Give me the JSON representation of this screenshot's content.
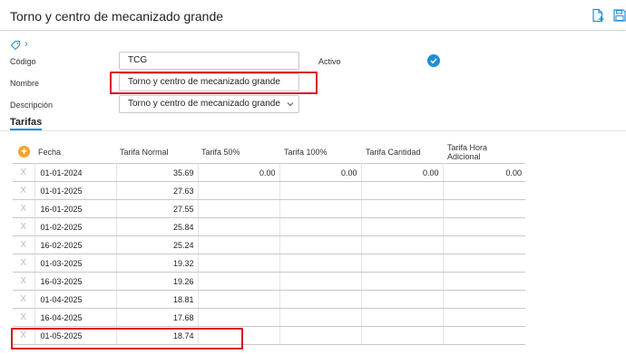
{
  "header": {
    "title": "Torno y centro de mecanizado grande"
  },
  "form": {
    "codigo_label": "Código",
    "codigo_value": "TCG",
    "nombre_label": "Nombre",
    "nombre_value": "Torno y centro de mecanizado grande",
    "descripcion_label": "Descripción",
    "descripcion_value": "Torno y centro de mecanizado grande",
    "activo_label": "Activo"
  },
  "tabs": [
    {
      "label": "Tarifas"
    }
  ],
  "table": {
    "add_icon": "+",
    "delete_icon": "X",
    "columns": {
      "fecha": "Fecha",
      "normal": "Tarifa Normal",
      "t50": "Tarifa 50%",
      "t100": "Tarifa 100%",
      "cantidad": "Tarifa Cantidad",
      "hora_adicional_1": "Tarifa Hora",
      "hora_adicional_2": "Adicional"
    },
    "rows": [
      {
        "fecha": "01-01-2024",
        "normal": "35.69",
        "t50": "0.00",
        "t100": "0.00",
        "cantidad": "0.00",
        "hora": "0.00"
      },
      {
        "fecha": "01-01-2025",
        "normal": "27.63",
        "t50": "",
        "t100": "",
        "cantidad": "",
        "hora": ""
      },
      {
        "fecha": "16-01-2025",
        "normal": "27.55",
        "t50": "",
        "t100": "",
        "cantidad": "",
        "hora": ""
      },
      {
        "fecha": "01-02-2025",
        "normal": "25.84",
        "t50": "",
        "t100": "",
        "cantidad": "",
        "hora": ""
      },
      {
        "fecha": "16-02-2025",
        "normal": "25.24",
        "t50": "",
        "t100": "",
        "cantidad": "",
        "hora": ""
      },
      {
        "fecha": "01-03-2025",
        "normal": "19.32",
        "t50": "",
        "t100": "",
        "cantidad": "",
        "hora": ""
      },
      {
        "fecha": "16-03-2025",
        "normal": "19.26",
        "t50": "",
        "t100": "",
        "cantidad": "",
        "hora": ""
      },
      {
        "fecha": "01-04-2025",
        "normal": "18.81",
        "t50": "",
        "t100": "",
        "cantidad": "",
        "hora": ""
      },
      {
        "fecha": "16-04-2025",
        "normal": "17.68",
        "t50": "",
        "t100": "",
        "cantidad": "",
        "hora": ""
      },
      {
        "fecha": "01-05-2025",
        "normal": "18.74",
        "t50": "",
        "t100": "",
        "cantidad": "",
        "hora": ""
      }
    ]
  },
  "colors": {
    "accent": "#1f8fd6",
    "highlight": "#d6141a",
    "add_button": "#f2a42a"
  }
}
